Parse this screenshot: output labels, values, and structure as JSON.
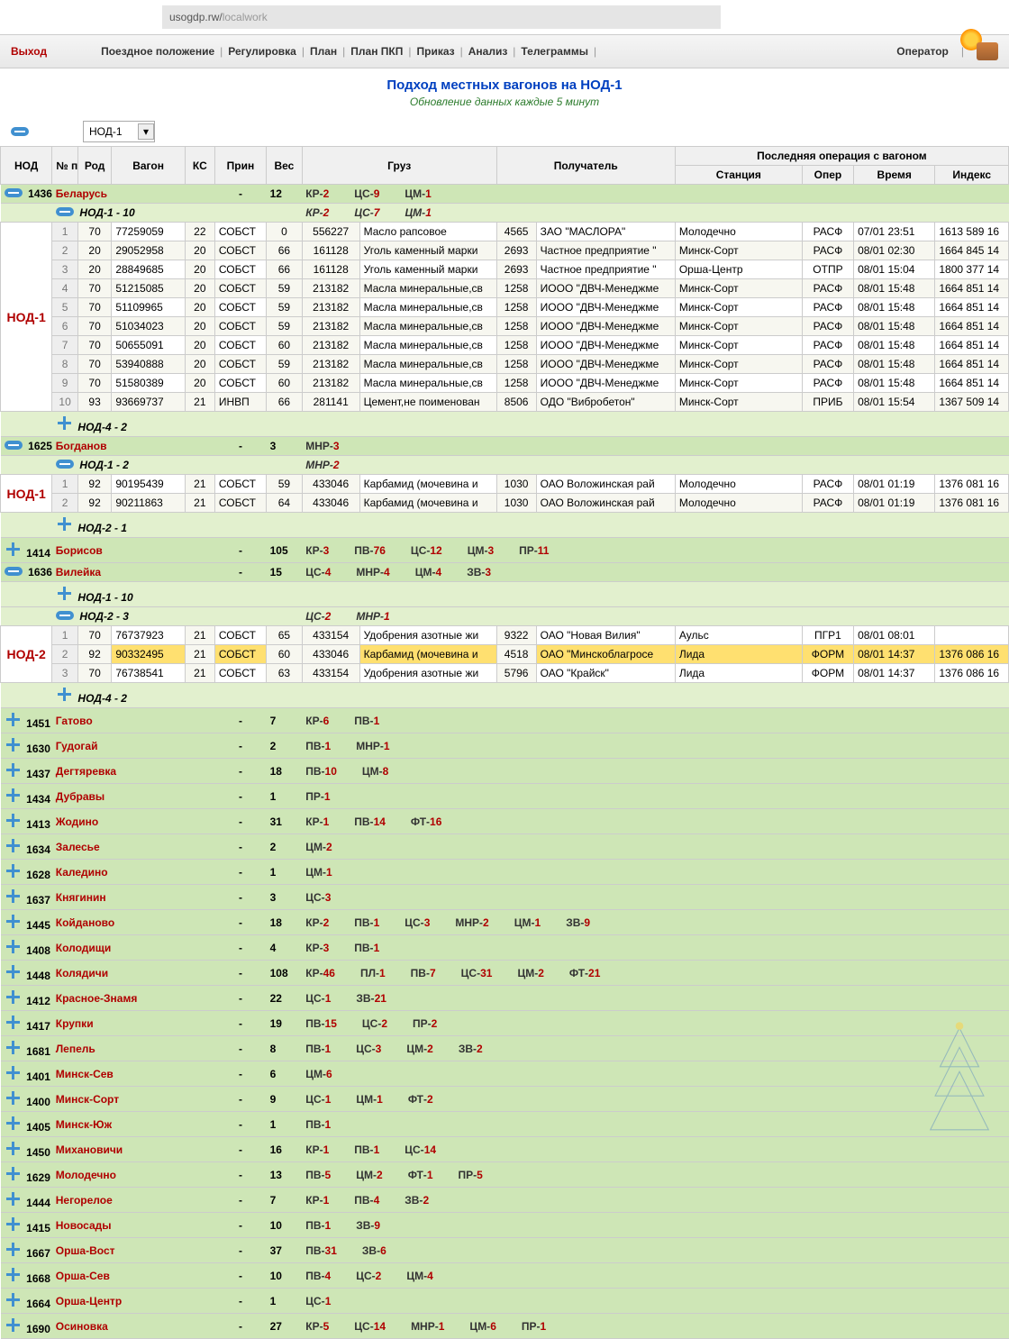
{
  "url_host": "usogdp.rw/",
  "url_path": "localwork",
  "menu": {
    "exit": "Выход",
    "items": [
      "Поездное положение",
      "Регулировка",
      "План",
      "План ПКП",
      "Приказ",
      "Анализ",
      "Телеграммы"
    ],
    "operator": "Оператор"
  },
  "title": "Подход местных вагонов на НОД-1",
  "subtitle": "Обновление данных каждые 5 минут",
  "selector": "НОД-1",
  "headers": {
    "nod": "НОД",
    "np": "№ пп",
    "rod": "Род",
    "vagon": "Вагон",
    "ks": "КС",
    "prin": "Прин",
    "ves": "Вес",
    "gruz": "Груз",
    "poluch": "Получатель",
    "lastop": "Последняя операция с вагоном",
    "stan": "Станция",
    "oper": "Опер",
    "time": "Время",
    "idx": "Индекс"
  },
  "g_belarus": {
    "code": "1436",
    "name": "Беларусь",
    "dash": "-",
    "total": "12",
    "chips": [
      [
        "КР-",
        "2"
      ],
      [
        "ЦС-",
        "9"
      ],
      [
        "ЦМ-",
        "1"
      ]
    ]
  },
  "g_bel_nod1": {
    "label": "НОД-1   -   10",
    "chips": [
      [
        "КР-",
        "2"
      ],
      [
        "ЦС-",
        "7"
      ],
      [
        "ЦМ-",
        "1"
      ]
    ]
  },
  "nod1_label": "НОД-1",
  "rows_nod1": [
    {
      "n": "1",
      "rod": "70",
      "vag": "77259059",
      "ks": "22",
      "prin": "СОБСТ",
      "ves": "0",
      "gc": "556227",
      "gn": "Масло рапсовое",
      "pc": "4565",
      "pn": "ЗАО \"МАСЛОРА\"",
      "st": "Молодечно",
      "op": "РАСФ",
      "tm": "07/01 23:51",
      "ix": "1613 589 16"
    },
    {
      "n": "2",
      "rod": "20",
      "vag": "29052958",
      "ks": "20",
      "prin": "СОБСТ",
      "ves": "66",
      "gc": "161128",
      "gn": "Уголь каменный марки",
      "pc": "2693",
      "pn": "Частное предприятие \"",
      "st": "Минск-Сорт",
      "op": "РАСФ",
      "tm": "08/01 02:30",
      "ix": "1664 845 14"
    },
    {
      "n": "3",
      "rod": "20",
      "vag": "28849685",
      "ks": "20",
      "prin": "СОБСТ",
      "ves": "66",
      "gc": "161128",
      "gn": "Уголь каменный марки",
      "pc": "2693",
      "pn": "Частное предприятие \"",
      "st": "Орша-Центр",
      "op": "ОТПР",
      "tm": "08/01 15:04",
      "ix": "1800 377 14"
    },
    {
      "n": "4",
      "rod": "70",
      "vag": "51215085",
      "ks": "20",
      "prin": "СОБСТ",
      "ves": "59",
      "gc": "213182",
      "gn": "Масла минеральные,св",
      "pc": "1258",
      "pn": "ИООО \"ДВЧ-Менеджме",
      "st": "Минск-Сорт",
      "op": "РАСФ",
      "tm": "08/01 15:48",
      "ix": "1664 851 14"
    },
    {
      "n": "5",
      "rod": "70",
      "vag": "51109965",
      "ks": "20",
      "prin": "СОБСТ",
      "ves": "59",
      "gc": "213182",
      "gn": "Масла минеральные,св",
      "pc": "1258",
      "pn": "ИООО \"ДВЧ-Менеджме",
      "st": "Минск-Сорт",
      "op": "РАСФ",
      "tm": "08/01 15:48",
      "ix": "1664 851 14"
    },
    {
      "n": "6",
      "rod": "70",
      "vag": "51034023",
      "ks": "20",
      "prin": "СОБСТ",
      "ves": "59",
      "gc": "213182",
      "gn": "Масла минеральные,св",
      "pc": "1258",
      "pn": "ИООО \"ДВЧ-Менеджме",
      "st": "Минск-Сорт",
      "op": "РАСФ",
      "tm": "08/01 15:48",
      "ix": "1664 851 14"
    },
    {
      "n": "7",
      "rod": "70",
      "vag": "50655091",
      "ks": "20",
      "prin": "СОБСТ",
      "ves": "60",
      "gc": "213182",
      "gn": "Масла минеральные,св",
      "pc": "1258",
      "pn": "ИООО \"ДВЧ-Менеджме",
      "st": "Минск-Сорт",
      "op": "РАСФ",
      "tm": "08/01 15:48",
      "ix": "1664 851 14"
    },
    {
      "n": "8",
      "rod": "70",
      "vag": "53940888",
      "ks": "20",
      "prin": "СОБСТ",
      "ves": "59",
      "gc": "213182",
      "gn": "Масла минеральные,св",
      "pc": "1258",
      "pn": "ИООО \"ДВЧ-Менеджме",
      "st": "Минск-Сорт",
      "op": "РАСФ",
      "tm": "08/01 15:48",
      "ix": "1664 851 14"
    },
    {
      "n": "9",
      "rod": "70",
      "vag": "51580389",
      "ks": "20",
      "prin": "СОБСТ",
      "ves": "60",
      "gc": "213182",
      "gn": "Масла минеральные,св",
      "pc": "1258",
      "pn": "ИООО \"ДВЧ-Менеджме",
      "st": "Минск-Сорт",
      "op": "РАСФ",
      "tm": "08/01 15:48",
      "ix": "1664 851 14"
    },
    {
      "n": "10",
      "rod": "93",
      "vag": "93669737",
      "ks": "21",
      "prin": "ИНВП",
      "ves": "66",
      "gc": "281141",
      "gn": "Цемент,не поименован",
      "pc": "8506",
      "pn": "ОДО \"Вибробетон\"",
      "st": "Минск-Сорт",
      "op": "ПРИБ",
      "tm": "08/01 15:54",
      "ix": "1367 509 14"
    }
  ],
  "g_bel_nod4": "НОД-4   -   2",
  "g_bogdanov": {
    "code": "1625",
    "name": "Богданов",
    "total": "3",
    "chips": [
      [
        "МНР-",
        "3"
      ]
    ]
  },
  "g_bog_nod1": {
    "label": "НОД-1   -   2",
    "chips": [
      [
        "МНР-",
        "2"
      ]
    ]
  },
  "rows_bog": [
    {
      "n": "1",
      "rod": "92",
      "vag": "90195439",
      "ks": "21",
      "prin": "СОБСТ",
      "ves": "59",
      "gc": "433046",
      "gn": "Карбамид (мочевина и",
      "pc": "1030",
      "pn": "ОАО Воложинская рай",
      "st": "Молодечно",
      "op": "РАСФ",
      "tm": "08/01 01:19",
      "ix": "1376 081 16"
    },
    {
      "n": "2",
      "rod": "92",
      "vag": "90211863",
      "ks": "21",
      "prin": "СОБСТ",
      "ves": "64",
      "gc": "433046",
      "gn": "Карбамид (мочевина и",
      "pc": "1030",
      "pn": "ОАО Воложинская рай",
      "st": "Молодечно",
      "op": "РАСФ",
      "tm": "08/01 01:19",
      "ix": "1376 081 16"
    }
  ],
  "g_bog_nod2": "НОД-2   -   1",
  "g_borisov": {
    "code": "1414",
    "name": "Борисов",
    "total": "105",
    "chips": [
      [
        "КР-",
        "3"
      ],
      [
        "ПВ-",
        "76"
      ],
      [
        "ЦС-",
        "12"
      ],
      [
        "ЦМ-",
        "3"
      ],
      [
        "ПР-",
        "11"
      ]
    ]
  },
  "g_vileika": {
    "code": "1636",
    "name": "Вилейка",
    "total": "15",
    "chips": [
      [
        "ЦС-",
        "4"
      ],
      [
        "МНР-",
        "4"
      ],
      [
        "ЦМ-",
        "4"
      ],
      [
        "ЗВ-",
        "3"
      ]
    ]
  },
  "g_vil_nod1": "НОД-1   -   10",
  "g_vil_nod2": {
    "label": "НОД-2   -   3",
    "chips": [
      [
        "ЦС-",
        "2"
      ],
      [
        "МНР-",
        "1"
      ]
    ]
  },
  "nod2_label": "НОД-2",
  "rows_vil": [
    {
      "n": "1",
      "rod": "70",
      "vag": "76737923",
      "ks": "21",
      "prin": "СОБСТ",
      "ves": "65",
      "gc": "433154",
      "gn": "Удобрения азотные жи",
      "pc": "9322",
      "pn": "ОАО \"Новая Вилия\"",
      "st": "Аульс",
      "op": "ПГР1",
      "tm": "08/01 08:01",
      "ix": ""
    },
    {
      "n": "2",
      "rod": "92",
      "vag": "90332495",
      "ks": "21",
      "prin": "СОБСТ",
      "ves": "60",
      "gc": "433046",
      "gn": "Карбамид (мочевина и",
      "pc": "4518",
      "pn": "ОАО \"Минскоблагросе",
      "st": "Лида",
      "op": "ФОРМ",
      "tm": "08/01 14:37",
      "ix": "1376 086 16",
      "hl": true
    },
    {
      "n": "3",
      "rod": "70",
      "vag": "76738541",
      "ks": "21",
      "prin": "СОБСТ",
      "ves": "63",
      "gc": "433154",
      "gn": "Удобрения азотные жи",
      "pc": "5796",
      "pn": "ОАО \"Крайск\"",
      "st": "Лида",
      "op": "ФОРМ",
      "tm": "08/01 14:37",
      "ix": "1376 086 16"
    }
  ],
  "g_vil_nod4": "НОД-4   -   2",
  "stations": [
    {
      "code": "1451",
      "name": "Гатово",
      "total": "7",
      "chips": [
        [
          "КР-",
          "6"
        ],
        [
          "ПВ-",
          "1"
        ]
      ]
    },
    {
      "code": "1630",
      "name": "Гудогай",
      "total": "2",
      "chips": [
        [
          "ПВ-",
          "1"
        ],
        [
          "МНР-",
          "1"
        ]
      ]
    },
    {
      "code": "1437",
      "name": "Дегтяревка",
      "total": "18",
      "chips": [
        [
          "ПВ-",
          "10"
        ],
        [
          "ЦМ-",
          "8"
        ]
      ]
    },
    {
      "code": "1434",
      "name": "Дубравы",
      "total": "1",
      "chips": [
        [
          "ПР-",
          "1"
        ]
      ]
    },
    {
      "code": "1413",
      "name": "Жодино",
      "total": "31",
      "chips": [
        [
          "КР-",
          "1"
        ],
        [
          "ПВ-",
          "14"
        ],
        [
          "ФТ-",
          "16"
        ]
      ]
    },
    {
      "code": "1634",
      "name": "Залесье",
      "total": "2",
      "chips": [
        [
          "ЦМ-",
          "2"
        ]
      ]
    },
    {
      "code": "1628",
      "name": "Каледино",
      "total": "1",
      "chips": [
        [
          "ЦМ-",
          "1"
        ]
      ]
    },
    {
      "code": "1637",
      "name": "Княгинин",
      "total": "3",
      "chips": [
        [
          "ЦС-",
          "3"
        ]
      ]
    },
    {
      "code": "1445",
      "name": "Койданово",
      "total": "18",
      "chips": [
        [
          "КР-",
          "2"
        ],
        [
          "ПВ-",
          "1"
        ],
        [
          "ЦС-",
          "3"
        ],
        [
          "МНР-",
          "2"
        ],
        [
          "ЦМ-",
          "1"
        ],
        [
          "ЗВ-",
          "9"
        ]
      ]
    },
    {
      "code": "1408",
      "name": "Колодищи",
      "total": "4",
      "chips": [
        [
          "КР-",
          "3"
        ],
        [
          "ПВ-",
          "1"
        ]
      ]
    },
    {
      "code": "1448",
      "name": "Колядичи",
      "total": "108",
      "chips": [
        [
          "КР-",
          "46"
        ],
        [
          "ПЛ-",
          "1"
        ],
        [
          "ПВ-",
          "7"
        ],
        [
          "ЦС-",
          "31"
        ],
        [
          "ЦМ-",
          "2"
        ],
        [
          "ФТ-",
          "21"
        ]
      ]
    },
    {
      "code": "1412",
      "name": "Красное-Знамя",
      "total": "22",
      "chips": [
        [
          "ЦС-",
          "1"
        ],
        [
          "ЗВ-",
          "21"
        ]
      ]
    },
    {
      "code": "1417",
      "name": "Крупки",
      "total": "19",
      "chips": [
        [
          "ПВ-",
          "15"
        ],
        [
          "ЦС-",
          "2"
        ],
        [
          "ПР-",
          "2"
        ]
      ]
    },
    {
      "code": "1681",
      "name": "Лепель",
      "total": "8",
      "chips": [
        [
          "ПВ-",
          "1"
        ],
        [
          "ЦС-",
          "3"
        ],
        [
          "ЦМ-",
          "2"
        ],
        [
          "ЗВ-",
          "2"
        ]
      ]
    },
    {
      "code": "1401",
      "name": "Минск-Сев",
      "total": "6",
      "chips": [
        [
          "ЦМ-",
          "6"
        ]
      ]
    },
    {
      "code": "1400",
      "name": "Минск-Сорт",
      "total": "9",
      "chips": [
        [
          "ЦС-",
          "1"
        ],
        [
          "ЦМ-",
          "1"
        ],
        [
          "ФТ-",
          "2"
        ]
      ]
    },
    {
      "code": "1405",
      "name": "Минск-Юж",
      "total": "1",
      "chips": [
        [
          "ПВ-",
          "1"
        ]
      ]
    },
    {
      "code": "1450",
      "name": "Михановичи",
      "total": "16",
      "chips": [
        [
          "КР-",
          "1"
        ],
        [
          "ПВ-",
          "1"
        ],
        [
          "ЦС-",
          "14"
        ]
      ]
    },
    {
      "code": "1629",
      "name": "Молодечно",
      "total": "13",
      "chips": [
        [
          "ПВ-",
          "5"
        ],
        [
          "ЦМ-",
          "2"
        ],
        [
          "ФТ-",
          "1"
        ],
        [
          "ПР-",
          "5"
        ]
      ]
    },
    {
      "code": "1444",
      "name": "Негорелое",
      "total": "7",
      "chips": [
        [
          "КР-",
          "1"
        ],
        [
          "ПВ-",
          "4"
        ],
        [
          "ЗВ-",
          "2"
        ]
      ]
    },
    {
      "code": "1415",
      "name": "Новосады",
      "total": "10",
      "chips": [
        [
          "ПВ-",
          "1"
        ],
        [
          "ЗВ-",
          "9"
        ]
      ]
    },
    {
      "code": "1667",
      "name": "Орша-Вост",
      "total": "37",
      "chips": [
        [
          "ПВ-",
          "31"
        ],
        [
          "ЗВ-",
          "6"
        ]
      ]
    },
    {
      "code": "1668",
      "name": "Орша-Сев",
      "total": "10",
      "chips": [
        [
          "ПВ-",
          "4"
        ],
        [
          "ЦС-",
          "2"
        ],
        [
          "ЦМ-",
          "4"
        ]
      ]
    },
    {
      "code": "1664",
      "name": "Орша-Центр",
      "total": "1",
      "chips": [
        [
          "ЦС-",
          "1"
        ]
      ]
    },
    {
      "code": "1690",
      "name": "Осиновка",
      "total": "27",
      "chips": [
        [
          "КР-",
          "5"
        ],
        [
          "ЦС-",
          "14"
        ],
        [
          "МНР-",
          "1"
        ],
        [
          "ЦМ-",
          "6"
        ],
        [
          "ПР-",
          "1"
        ]
      ]
    }
  ]
}
